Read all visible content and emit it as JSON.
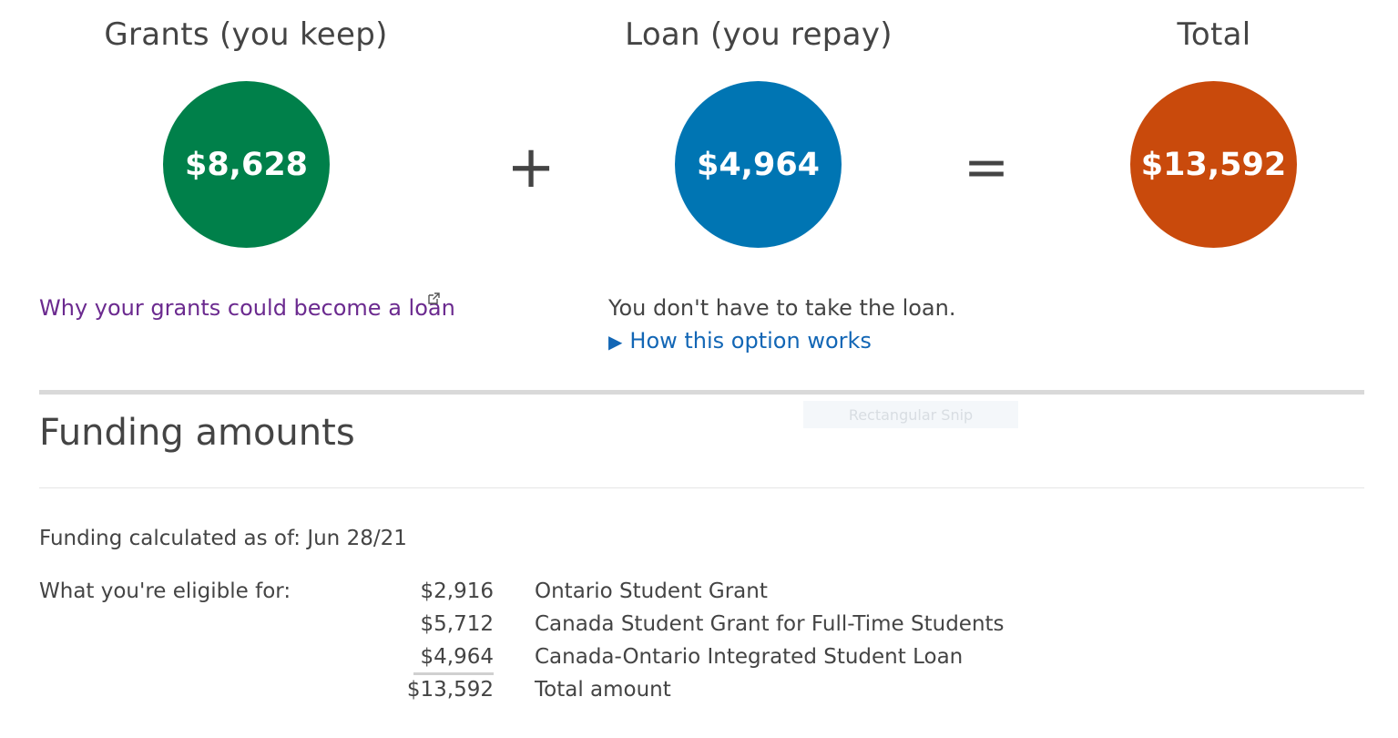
{
  "summary": {
    "grants": {
      "title": "Grants (you keep)",
      "amount": "$8,628",
      "color": "#00804a"
    },
    "plus": "+",
    "loan": {
      "title": "Loan (you repay)",
      "amount": "$4,964",
      "color": "#0075b3"
    },
    "equals": "=",
    "total": {
      "title": "Total",
      "amount": "$13,592",
      "color": "#c94a0c"
    }
  },
  "links": {
    "grants_loan": "Why your grants could become a loan",
    "loan_note": "You don't have to take the loan.",
    "how_option": "How this option works"
  },
  "overlay": {
    "label": "Rectangular Snip"
  },
  "funding": {
    "title": "Funding amounts",
    "calculated": "Funding calculated as of: Jun 28/21",
    "eligible_label": "What you're eligible for:",
    "rows": [
      {
        "amount": "$2,916",
        "label": "Ontario Student Grant"
      },
      {
        "amount": "$5,712",
        "label": "Canada Student Grant for Full-Time Students"
      },
      {
        "amount": "$4,964",
        "label": "Canada-Ontario Integrated Student Loan"
      }
    ],
    "total": {
      "amount": "$13,592",
      "label": "Total amount"
    }
  }
}
